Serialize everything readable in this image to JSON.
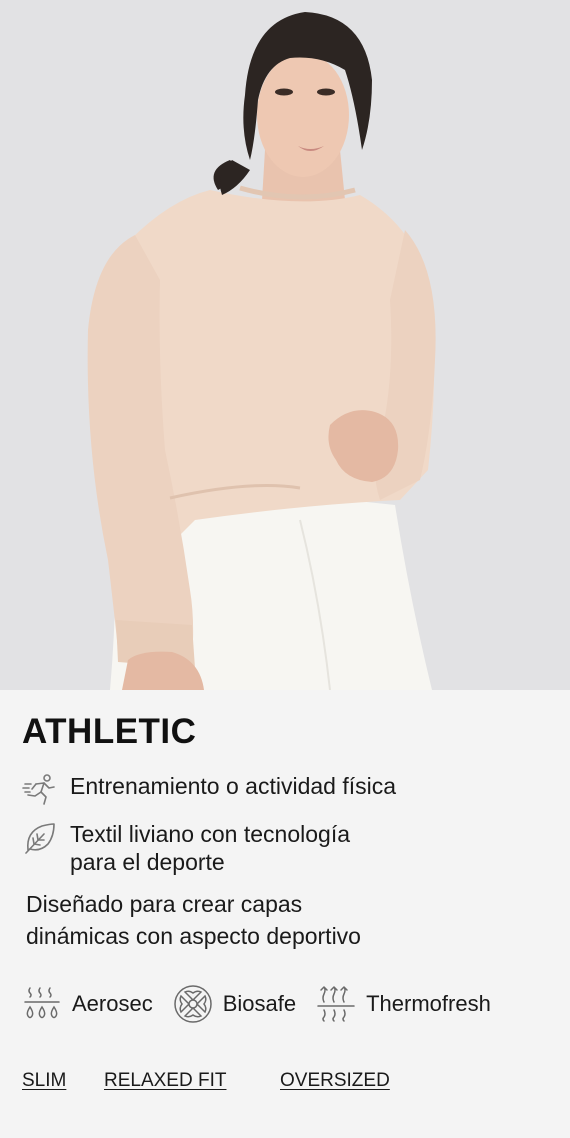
{
  "hero": {
    "alt": "Modelo con buzo rosa claro y pantalón blanco"
  },
  "category": {
    "title": "ATHLETIC"
  },
  "features": [
    {
      "icon": "runner-icon",
      "text": "Entrenamiento o actividad física"
    },
    {
      "icon": "leaf-icon",
      "line1": "Textil liviano con tecnología",
      "line2": "para el deporte"
    }
  ],
  "description": {
    "line1": "Diseñado para crear capas",
    "line2": "dinámicas con aspecto deportivo"
  },
  "technologies": [
    {
      "icon": "aerosec-icon",
      "label": "Aerosec"
    },
    {
      "icon": "biosafe-icon",
      "label": "Biosafe"
    },
    {
      "icon": "thermofresh-icon",
      "label": "Thermofresh"
    }
  ],
  "fits": [
    {
      "label": "SLIM"
    },
    {
      "label": "RELAXED FIT"
    },
    {
      "label": "OVERSIZED"
    }
  ],
  "colors": {
    "background": "#f4f4f4",
    "sweater": "#f0d9c8",
    "pants": "#f6f4ef",
    "text": "#1a1a1a",
    "icon": "#7a7a7a"
  }
}
